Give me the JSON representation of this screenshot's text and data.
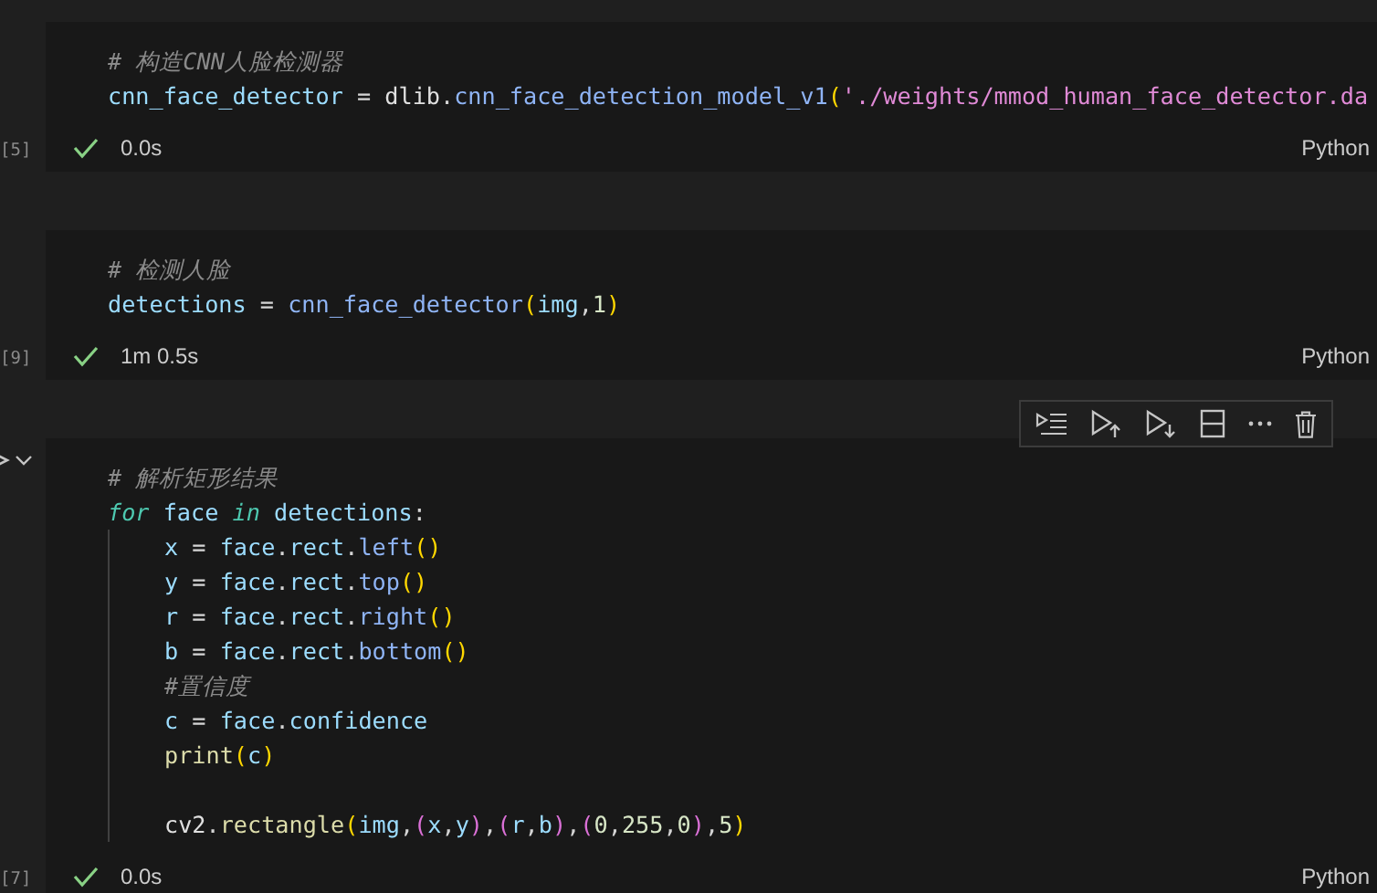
{
  "cells": [
    {
      "execution_count": "[5]",
      "focused": false,
      "time": "0.0s",
      "language": "Python",
      "lines": [
        {
          "kind": "code",
          "tokens": [
            {
              "text": "# 构造CNN人脸检测器",
              "kind": "comment"
            }
          ]
        },
        {
          "kind": "code",
          "tokens": [
            {
              "text": "cnn_face_detector",
              "kind": "variable"
            },
            {
              "text": " = ",
              "kind": "punct"
            },
            {
              "text": "dlib",
              "kind": "module"
            },
            {
              "text": ".",
              "kind": "punct"
            },
            {
              "text": "cnn_face_detection_model_v1",
              "kind": "method"
            },
            {
              "text": "(",
              "kind": "bracket1"
            },
            {
              "text": "'./weights/mmod_human_face_detector.da",
              "kind": "string"
            }
          ]
        }
      ]
    },
    {
      "execution_count": "[9]",
      "focused": false,
      "time": "1m 0.5s",
      "language": "Python",
      "lines": [
        {
          "kind": "code",
          "tokens": [
            {
              "text": "# 检测人脸",
              "kind": "comment"
            }
          ]
        },
        {
          "kind": "code",
          "tokens": [
            {
              "text": "detections",
              "kind": "variable"
            },
            {
              "text": " = ",
              "kind": "punct"
            },
            {
              "text": "cnn_face_detector",
              "kind": "method"
            },
            {
              "text": "(",
              "kind": "bracket1"
            },
            {
              "text": "img",
              "kind": "variable"
            },
            {
              "text": ",",
              "kind": "punct"
            },
            {
              "text": "1",
              "kind": "number"
            },
            {
              "text": ")",
              "kind": "bracket1"
            }
          ]
        }
      ]
    },
    {
      "execution_count": "[7]",
      "focused": true,
      "time": "0.0s",
      "language": "Python",
      "lines": [
        {
          "kind": "code",
          "tokens": [
            {
              "text": "# 解析矩形结果",
              "kind": "comment"
            }
          ]
        },
        {
          "kind": "code",
          "tokens": [
            {
              "text": "for",
              "kind": "keyword"
            },
            {
              "text": " face ",
              "kind": "variable"
            },
            {
              "text": "in",
              "kind": "keyword"
            },
            {
              "text": " detections",
              "kind": "variable"
            },
            {
              "text": ":",
              "kind": "punct"
            }
          ],
          "children": [
            {
              "kind": "code",
              "tokens": [
                {
                  "text": "x",
                  "kind": "variable"
                },
                {
                  "text": " = ",
                  "kind": "punct"
                },
                {
                  "text": "face",
                  "kind": "variable"
                },
                {
                  "text": ".",
                  "kind": "punct"
                },
                {
                  "text": "rect",
                  "kind": "variable"
                },
                {
                  "text": ".",
                  "kind": "punct"
                },
                {
                  "text": "left",
                  "kind": "method"
                },
                {
                  "text": "()",
                  "kind": "bracket1"
                }
              ]
            },
            {
              "kind": "code",
              "tokens": [
                {
                  "text": "y",
                  "kind": "variable"
                },
                {
                  "text": " = ",
                  "kind": "punct"
                },
                {
                  "text": "face",
                  "kind": "variable"
                },
                {
                  "text": ".",
                  "kind": "punct"
                },
                {
                  "text": "rect",
                  "kind": "variable"
                },
                {
                  "text": ".",
                  "kind": "punct"
                },
                {
                  "text": "top",
                  "kind": "method"
                },
                {
                  "text": "()",
                  "kind": "bracket1"
                }
              ]
            },
            {
              "kind": "code",
              "tokens": [
                {
                  "text": "r",
                  "kind": "variable"
                },
                {
                  "text": " = ",
                  "kind": "punct"
                },
                {
                  "text": "face",
                  "kind": "variable"
                },
                {
                  "text": ".",
                  "kind": "punct"
                },
                {
                  "text": "rect",
                  "kind": "variable"
                },
                {
                  "text": ".",
                  "kind": "punct"
                },
                {
                  "text": "right",
                  "kind": "method"
                },
                {
                  "text": "()",
                  "kind": "bracket1"
                }
              ]
            },
            {
              "kind": "code",
              "tokens": [
                {
                  "text": "b",
                  "kind": "variable"
                },
                {
                  "text": " = ",
                  "kind": "punct"
                },
                {
                  "text": "face",
                  "kind": "variable"
                },
                {
                  "text": ".",
                  "kind": "punct"
                },
                {
                  "text": "rect",
                  "kind": "variable"
                },
                {
                  "text": ".",
                  "kind": "punct"
                },
                {
                  "text": "bottom",
                  "kind": "method"
                },
                {
                  "text": "()",
                  "kind": "bracket1"
                }
              ]
            },
            {
              "kind": "code",
              "tokens": [
                {
                  "text": "#置信度",
                  "kind": "comment"
                }
              ]
            },
            {
              "kind": "code",
              "tokens": [
                {
                  "text": "c",
                  "kind": "variable"
                },
                {
                  "text": " = ",
                  "kind": "punct"
                },
                {
                  "text": "face",
                  "kind": "variable"
                },
                {
                  "text": ".",
                  "kind": "punct"
                },
                {
                  "text": "confidence",
                  "kind": "variable"
                }
              ]
            },
            {
              "kind": "code",
              "tokens": [
                {
                  "text": "print",
                  "kind": "function"
                },
                {
                  "text": "(",
                  "kind": "bracket1"
                },
                {
                  "text": "c",
                  "kind": "variable"
                },
                {
                  "text": ")",
                  "kind": "bracket1"
                }
              ]
            },
            {
              "kind": "blank"
            },
            {
              "kind": "code",
              "tokens": [
                {
                  "text": "cv2",
                  "kind": "module"
                },
                {
                  "text": ".",
                  "kind": "punct"
                },
                {
                  "text": "rectangle",
                  "kind": "function"
                },
                {
                  "text": "(",
                  "kind": "bracket1"
                },
                {
                  "text": "img",
                  "kind": "variable"
                },
                {
                  "text": ",",
                  "kind": "punct"
                },
                {
                  "text": "(",
                  "kind": "bracket2"
                },
                {
                  "text": "x",
                  "kind": "variable"
                },
                {
                  "text": ",",
                  "kind": "punct"
                },
                {
                  "text": "y",
                  "kind": "variable"
                },
                {
                  "text": ")",
                  "kind": "bracket2"
                },
                {
                  "text": ",",
                  "kind": "punct"
                },
                {
                  "text": "(",
                  "kind": "bracket2"
                },
                {
                  "text": "r",
                  "kind": "variable"
                },
                {
                  "text": ",",
                  "kind": "punct"
                },
                {
                  "text": "b",
                  "kind": "variable"
                },
                {
                  "text": ")",
                  "kind": "bracket2"
                },
                {
                  "text": ",",
                  "kind": "punct"
                },
                {
                  "text": "(",
                  "kind": "bracket2"
                },
                {
                  "text": "0",
                  "kind": "number"
                },
                {
                  "text": ",",
                  "kind": "punct"
                },
                {
                  "text": "255",
                  "kind": "number"
                },
                {
                  "text": ",",
                  "kind": "punct"
                },
                {
                  "text": "0",
                  "kind": "number"
                },
                {
                  "text": ")",
                  "kind": "bracket2"
                },
                {
                  "text": ",",
                  "kind": "punct"
                },
                {
                  "text": "5",
                  "kind": "number"
                },
                {
                  "text": ")",
                  "kind": "bracket1"
                }
              ]
            }
          ]
        }
      ]
    }
  ]
}
